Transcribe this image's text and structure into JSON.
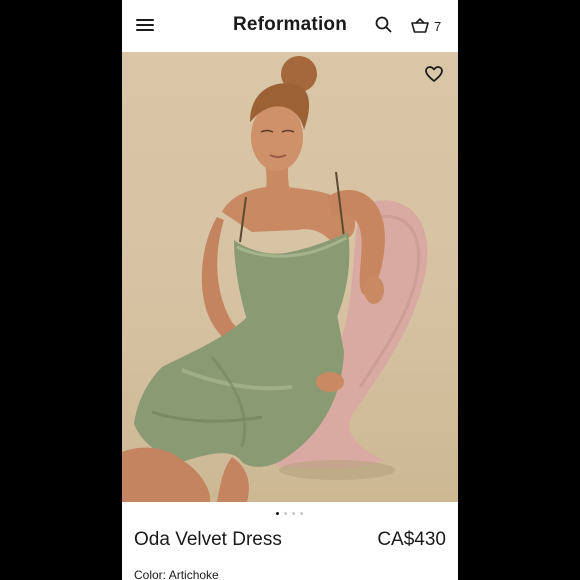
{
  "header": {
    "brand": "Reformation",
    "cart_count": "7",
    "menu_icon": "hamburger-menu-icon",
    "search_icon": "search-icon",
    "cart_icon": "basket-icon"
  },
  "product": {
    "favorite_icon": "heart-outline-icon",
    "image_count": 4,
    "active_image": 1,
    "name": "Oda Velvet Dress",
    "price": "CA$430",
    "color_label": "Color:",
    "color_value": "Artichoke"
  },
  "colors": {
    "dress": "#8a9a72",
    "chair": "#d9aaa2",
    "background": "#d8c5a5"
  }
}
